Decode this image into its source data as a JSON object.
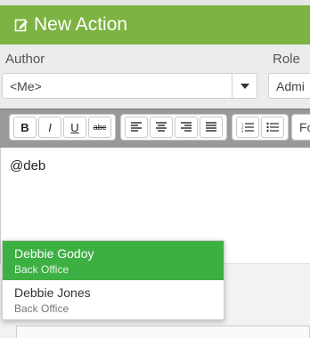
{
  "header": {
    "title": "New Action",
    "icon": "edit-icon"
  },
  "form": {
    "author_label": "Author",
    "author_value": "<Me>",
    "role_label": "Role",
    "role_value": "Admi"
  },
  "toolbar": {
    "bold": "B",
    "italic": "I",
    "underline": "U",
    "strike": "abc",
    "font_label": "Fo"
  },
  "editor": {
    "text": "@deb"
  },
  "mentions": [
    {
      "name": "Debbie Godoy",
      "department": "Back Office",
      "selected": true
    },
    {
      "name": "Debbie Jones",
      "department": "Back Office",
      "selected": false
    }
  ],
  "colors": {
    "header": "#7cb342",
    "selected": "#3cb043",
    "toolbar": "#999999"
  }
}
